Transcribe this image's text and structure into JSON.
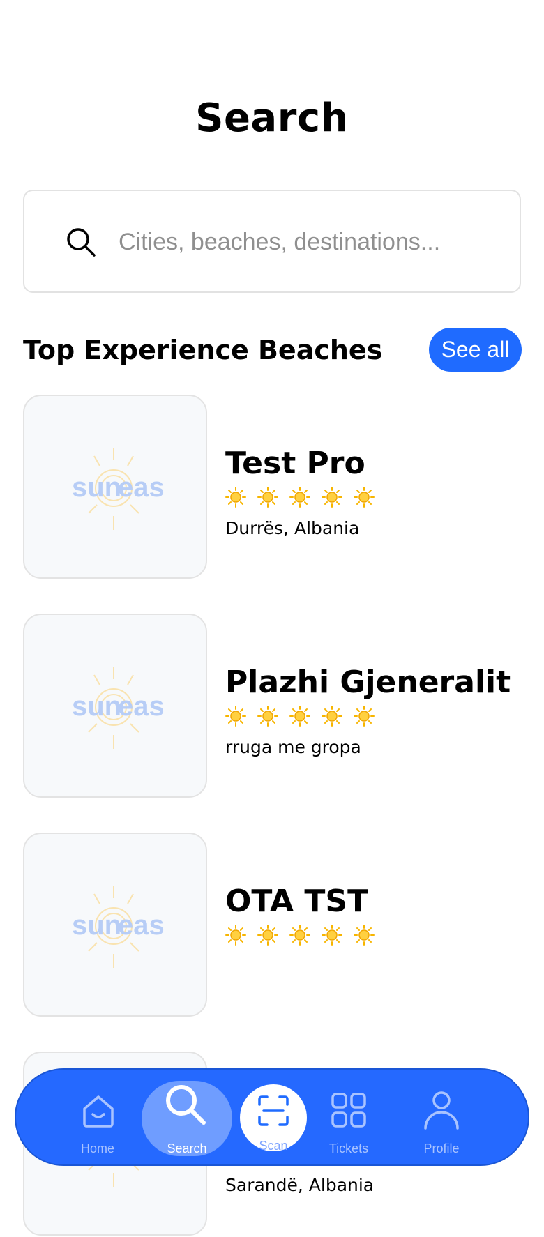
{
  "header": {
    "title": "Search"
  },
  "search": {
    "placeholder": "Cities, beaches, destinations..."
  },
  "section": {
    "title": "Top Experience Beaches",
    "see_all_label": "See all"
  },
  "beaches": [
    {
      "name": "Test Pro",
      "location": "Durrës, Albania",
      "rating": 5
    },
    {
      "name": "Plazhi Gjeneralit",
      "location": "rruga me gropa",
      "rating": 5
    },
    {
      "name": "OTA TST",
      "location": "",
      "rating": 5
    },
    {
      "name": "",
      "location": "Sarandë, Albania",
      "rating": 5
    }
  ],
  "placeholder_logo": {
    "left": "sun",
    "right": "easy"
  },
  "nav": {
    "items": [
      {
        "label": "Home",
        "icon": "home-icon"
      },
      {
        "label": "Search",
        "icon": "search-icon",
        "active": true
      },
      {
        "label": "Scan",
        "icon": "scan-icon"
      },
      {
        "label": "Tickets",
        "icon": "grid-icon"
      },
      {
        "label": "Profile",
        "icon": "profile-icon"
      }
    ]
  },
  "colors": {
    "accent": "#1f6bff",
    "nav_bg": "#2569ff",
    "star": "#f7b500",
    "logo_text": "#b7cdf6"
  }
}
